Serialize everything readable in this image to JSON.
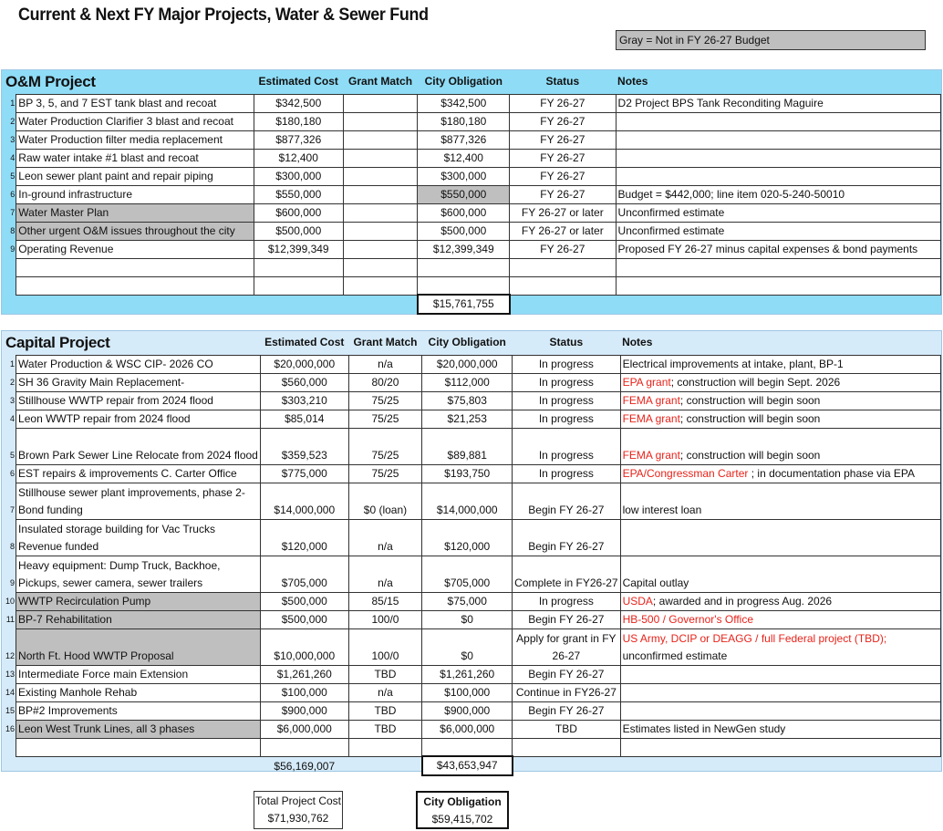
{
  "title": "Current & Next FY Major Projects, Water & Sewer Fund",
  "legend": "Gray = Not in FY 26-27 Budget",
  "columns": {
    "estimated_cost": "Estimated Cost",
    "grant_match": "Grant Match",
    "city_obligation": "City Obligation",
    "status": "Status",
    "notes": "Notes"
  },
  "om": {
    "heading": "O&M Project",
    "rows": [
      {
        "num": "1",
        "project": "BP 3, 5, and 7 EST tank blast and recoat",
        "cost": "$342,500",
        "grant": "",
        "city": "$342,500",
        "status": "FY 26-27",
        "notes": "D2 Project BPS Tank Reconditing Maguire"
      },
      {
        "num": "2",
        "project": "Water Production Clarifier 3 blast and recoat",
        "cost": "$180,180",
        "grant": "",
        "city": "$180,180",
        "status": "FY 26-27",
        "notes": ""
      },
      {
        "num": "3",
        "project": "Water Production filter media replacement",
        "cost": "$877,326",
        "grant": "",
        "city": "$877,326",
        "status": "FY 26-27",
        "notes": ""
      },
      {
        "num": "4",
        "project": "Raw water intake #1 blast and recoat",
        "cost": "$12,400",
        "grant": "",
        "city": "$12,400",
        "status": "FY 26-27",
        "notes": ""
      },
      {
        "num": "5",
        "project": "Leon sewer plant paint and repair piping",
        "cost": "$300,000",
        "grant": "",
        "city": "$300,000",
        "status": "FY 26-27",
        "notes": ""
      },
      {
        "num": "6",
        "project": "In-ground infrastructure",
        "cost": "$550,000",
        "grant": "",
        "city": "$550,000",
        "status": "FY 26-27",
        "notes": "Budget = $442,000; line item 020-5-240-50010"
      },
      {
        "num": "7",
        "project": "Water Master Plan",
        "cost": "$600,000",
        "grant": "",
        "city": "$600,000",
        "status": "FY 26-27 or later",
        "notes": "Unconfirmed estimate"
      },
      {
        "num": "8",
        "project": "Other urgent O&M issues throughout the city",
        "cost": "$500,000",
        "grant": "",
        "city": "$500,000",
        "status": "FY 26-27 or later",
        "notes": "Unconfirmed estimate"
      },
      {
        "num": "9",
        "project": "Operating Revenue",
        "cost": "$12,399,349",
        "grant": "",
        "city": "$12,399,349",
        "status": "FY 26-27",
        "notes": "Proposed FY 26-27 minus capital expenses & bond payments"
      }
    ],
    "total_city": "$15,761,755"
  },
  "capital": {
    "heading": "Capital Project",
    "rows": [
      {
        "num": "1",
        "project": "Water Production & WSC CIP- 2026 CO",
        "cost": "$20,000,000",
        "grant": "n/a",
        "city": "$20,000,000",
        "status": "In progress",
        "notes_red": "",
        "notes": "Electrical improvements at intake, plant, BP-1"
      },
      {
        "num": "2",
        "project": "SH 36 Gravity Main Replacement-",
        "cost": "$560,000",
        "grant": "80/20",
        "city": "$112,000",
        "status": "In progress",
        "notes_red": "EPA grant",
        "notes": "; construction will begin Sept. 2026"
      },
      {
        "num": "3",
        "project": "Stillhouse WWTP repair from 2024 flood",
        "cost": "$303,210",
        "grant": "75/25",
        "city": "$75,803",
        "status": "In progress",
        "notes_red": "FEMA grant",
        "notes": "; construction will begin soon"
      },
      {
        "num": "4",
        "project": "Leon WWTP repair from 2024 flood",
        "cost": "$85,014",
        "grant": "75/25",
        "city": "$21,253",
        "status": "In progress",
        "notes_red": "FEMA grant",
        "notes": "; construction will begin soon"
      },
      {
        "num": "5",
        "project": "Brown Park Sewer Line Relocate from 2024 flood",
        "cost": "$359,523",
        "grant": "75/25",
        "city": "$89,881",
        "status": "In progress",
        "notes_red": "FEMA grant",
        "notes": "; construction will begin soon"
      },
      {
        "num": "6",
        "project": "EST repairs & improvements C. Carter Office",
        "cost": "$775,000",
        "grant": "75/25",
        "city": "$193,750",
        "status": "In progress",
        "notes_red": "EPA/Congressman Carter",
        "notes": " ; in documentation phase via EPA"
      },
      {
        "num": "7",
        "project": "Stillhouse sewer plant improvements, phase 2- Bond funding",
        "cost": "$14,000,000",
        "grant": "$0 (loan)",
        "city": "$14,000,000",
        "status": "Begin FY 26-27",
        "notes_red": "",
        "notes": "low interest loan"
      },
      {
        "num": "8",
        "project": "Insulated storage building for Vac Trucks Revenue funded",
        "cost": "$120,000",
        "grant": "n/a",
        "city": "$120,000",
        "status": "Begin FY 26-27",
        "notes_red": "",
        "notes": ""
      },
      {
        "num": "9",
        "project": "Heavy equipment: Dump Truck, Backhoe, Pickups, sewer camera, sewer trailers",
        "cost": "$705,000",
        "grant": "n/a",
        "city": "$705,000",
        "status": "Complete in FY26-27",
        "notes_red": "",
        "notes": "Capital outlay"
      },
      {
        "num": "10",
        "project": "WWTP Recirculation Pump",
        "cost": "$500,000",
        "grant": "85/15",
        "city": "$75,000",
        "status": "In progress",
        "notes_red": "USDA",
        "notes": "; awarded and in progress Aug. 2026"
      },
      {
        "num": "11",
        "project": "BP-7 Rehabilitation",
        "cost": "$500,000",
        "grant": "100/0",
        "city": "$0",
        "status": "Begin FY 26-27",
        "notes_red": "HB-500 / Governor's Office",
        "notes": ""
      },
      {
        "num": "12",
        "project": "North Ft. Hood WWTP Proposal",
        "cost": "$10,000,000",
        "grant": "100/0",
        "city": "$0",
        "status": "Apply for grant in FY 26-27",
        "notes_red": "US Army, DCIP or DEAGG / full Federal project (TBD);",
        "notes": "unconfirmed estimate"
      },
      {
        "num": "13",
        "project": "Intermediate Force main Extension",
        "cost": "$1,261,260",
        "grant": "TBD",
        "city": "$1,261,260",
        "status": "Begin FY 26-27",
        "notes_red": "",
        "notes": ""
      },
      {
        "num": "14",
        "project": "Existing Manhole Rehab",
        "cost": "$100,000",
        "grant": "n/a",
        "city": "$100,000",
        "status": "Continue in FY26-27",
        "notes_red": "",
        "notes": ""
      },
      {
        "num": "15",
        "project": "BP#2 Improvements",
        "cost": "$900,000",
        "grant": "TBD",
        "city": "$900,000",
        "status": "Begin FY 26-27",
        "notes_red": "",
        "notes": ""
      },
      {
        "num": "16",
        "project": "Leon West Trunk Lines, all 3 phases",
        "cost": "$6,000,000",
        "grant": "TBD",
        "city": "$6,000,000",
        "status": "TBD",
        "notes_red": "",
        "notes": "Estimates listed in NewGen study"
      }
    ],
    "total_cost": "$56,169,007",
    "total_city": "$43,653,947"
  },
  "totals": {
    "project_label": "Total Project Cost",
    "project_value": "$71,930,762",
    "city_label": "City Obligation",
    "city_value": "$59,415,702"
  }
}
